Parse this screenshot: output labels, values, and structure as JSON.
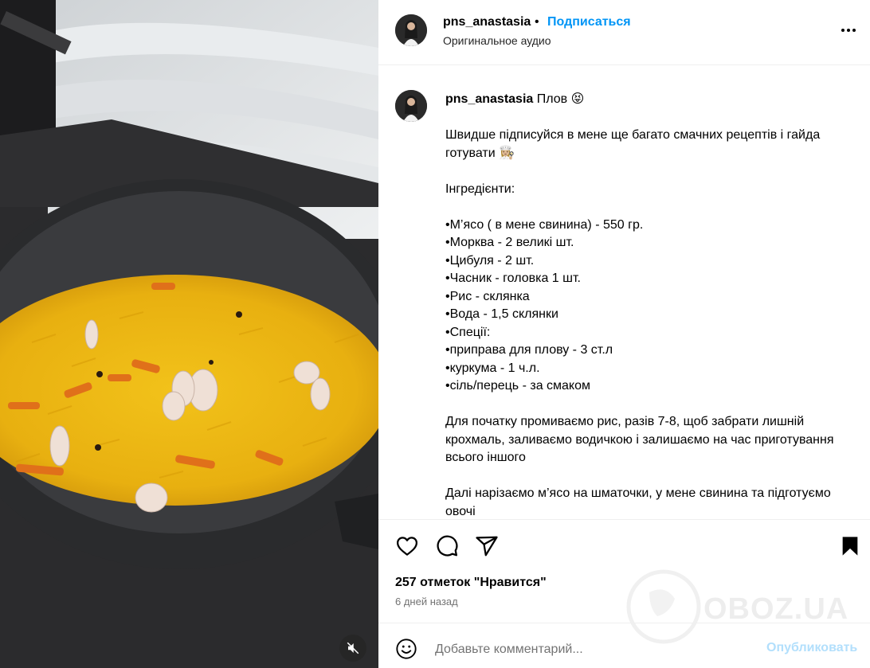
{
  "author": {
    "username": "pns_anastasia",
    "follow_label": "Подписаться",
    "separator": "•",
    "audio_label": "Оригинальное аудио"
  },
  "caption": {
    "username": "pns_anastasia",
    "title": "Плов 😝",
    "paragraph1": "Швидше підписуйся в мене ще багато смачних рецептів і гайда готувати 👩🏼‍🍳",
    "ingredients_heading": "Інгредієнти:",
    "ingredients": [
      "•М’ясо ( в мене свинина) - 550 гр.",
      "•Морква - 2 великі шт.",
      "•Цибуля - 2 шт.",
      "•Часник - головка 1 шт.",
      "•Рис - склянка",
      "•Вода - 1,5 склянки",
      "•Спеції:",
      "•приправа для плову - 3 ст.л",
      "•куркума - 1 ч.л.",
      "•сіль/перець - за смаком"
    ],
    "paragraph2": "Для початку промиваємо рис, разів 7-8, щоб забрати лишній крохмаль, заливаємо водичкою і залишаємо на час приготування всього іншого",
    "paragraph3": "Далі нарізаємо м’ясо на шматочки, у мене свинина та підготуємо овочі"
  },
  "stats": {
    "likes": "257 отметок \"Нравится\"",
    "time": "6 дней назад"
  },
  "comment": {
    "placeholder": "Добавьте комментарий...",
    "publish_label": "Опубликовать"
  },
  "watermark": {
    "text": "OBOZ.UA"
  },
  "colors": {
    "accent": "#0095f6",
    "publish_disabled": "#b2dffc",
    "secondary_text": "#737373",
    "divider": "#efefef"
  },
  "icons": {
    "more": "more-horizontal-icon",
    "like": "heart-icon",
    "comment": "comment-icon",
    "share": "share-icon",
    "save": "bookmark-icon",
    "emoji": "emoji-icon",
    "mute": "volume-off-icon"
  }
}
